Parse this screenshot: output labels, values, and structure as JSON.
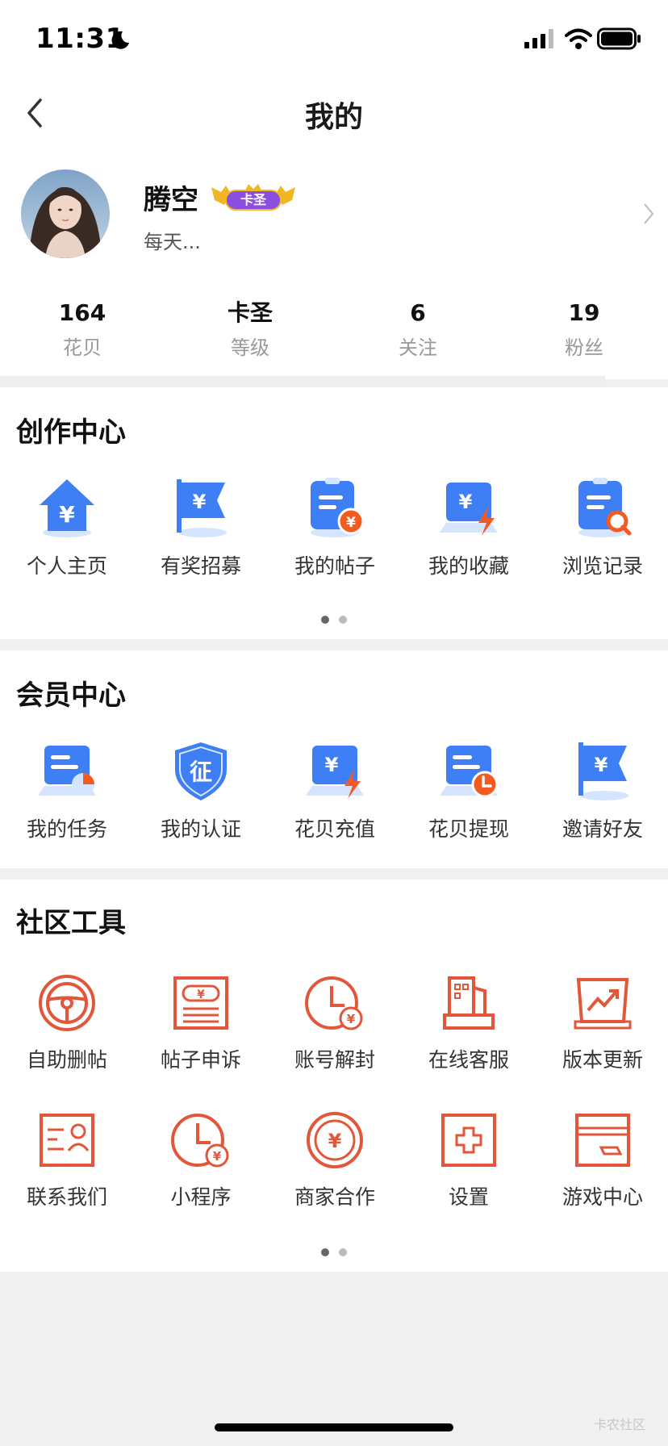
{
  "status_bar": {
    "time": "11:31",
    "icons": [
      "moon-icon",
      "signal-icon",
      "wifi-icon",
      "battery-icon"
    ]
  },
  "nav": {
    "title": "我的",
    "back_icon": "chevron-left-icon"
  },
  "profile": {
    "username": "腾空",
    "badge_text": "卡圣",
    "bio": "每天...",
    "stats": [
      {
        "value": "164",
        "label": "花贝"
      },
      {
        "value": "卡圣",
        "label": "等级"
      },
      {
        "value": "6",
        "label": "关注"
      },
      {
        "value": "19",
        "label": "粉丝"
      }
    ]
  },
  "creation_center": {
    "title": "创作中心",
    "items": [
      {
        "label": "个人主页",
        "icon": "home-yuan-icon"
      },
      {
        "label": "有奖招募",
        "icon": "flag-yuan-icon"
      },
      {
        "label": "我的帖子",
        "icon": "document-coin-icon"
      },
      {
        "label": "我的收藏",
        "icon": "monitor-yuan-lightning-icon"
      },
      {
        "label": "浏览记录",
        "icon": "clipboard-search-icon"
      }
    ],
    "pages": 2,
    "active_page": 1
  },
  "member_center": {
    "title": "会员中心",
    "items": [
      {
        "label": "我的任务",
        "icon": "monitor-pie-icon"
      },
      {
        "label": "我的认证",
        "icon": "shield-certification-icon",
        "icon_text": "征"
      },
      {
        "label": "花贝充值",
        "icon": "monitor-yuan-lightning-icon"
      },
      {
        "label": "花贝提现",
        "icon": "monitor-clock-icon"
      },
      {
        "label": "邀请好友",
        "icon": "flag-yuan-icon"
      }
    ]
  },
  "community_tools": {
    "title": "社区工具",
    "items": [
      {
        "label": "自助删帖",
        "icon": "steering-wheel-icon"
      },
      {
        "label": "帖子申诉",
        "icon": "ticket-yuan-icon"
      },
      {
        "label": "账号解封",
        "icon": "clock-yuan-icon"
      },
      {
        "label": "在线客服",
        "icon": "building-icon"
      },
      {
        "label": "版本更新",
        "icon": "trend-chart-icon"
      },
      {
        "label": "联系我们",
        "icon": "contact-card-icon"
      },
      {
        "label": "小程序",
        "icon": "clock-yuan-icon"
      },
      {
        "label": "商家合作",
        "icon": "coin-yuan-icon"
      },
      {
        "label": "设置",
        "icon": "plus-box-icon"
      },
      {
        "label": "游戏中心",
        "icon": "card-icon"
      }
    ],
    "pages": 2,
    "active_page": 1
  },
  "watermark": "卡农社区",
  "colors": {
    "blue": "#3f7ff5",
    "light_blue": "#d6e5ff",
    "orange": "#f35a21",
    "tool_red": "#e2573a",
    "gold": "#f2b623",
    "purple": "#8b4fe0"
  }
}
